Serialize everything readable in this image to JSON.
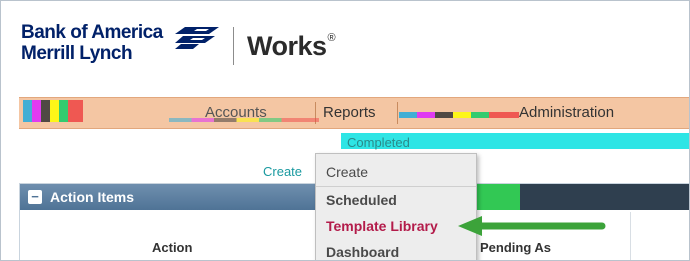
{
  "brand": {
    "line1": "Bank of America",
    "line2": "Merrill Lynch",
    "product": "Works",
    "product_mark": "®",
    "flag_color": "#012169",
    "flag_accent": "#e31837"
  },
  "nav": {
    "items": [
      "Accounts",
      "Reports",
      "Administration"
    ]
  },
  "subrow": {
    "completed": "Completed",
    "create_link": "Create"
  },
  "panel": {
    "title": "Action Items",
    "collapse_symbol": "−",
    "columns": [
      "Action",
      "Pending As"
    ]
  },
  "dropdown": {
    "items": [
      "Create",
      "Scheduled",
      "Template Library",
      "Dashboard"
    ],
    "highlighted": "Template Library",
    "highlight_color": "#b31b4a"
  },
  "annotation": {
    "arrow_color": "#3ca33a",
    "points_to": "Template Library"
  }
}
